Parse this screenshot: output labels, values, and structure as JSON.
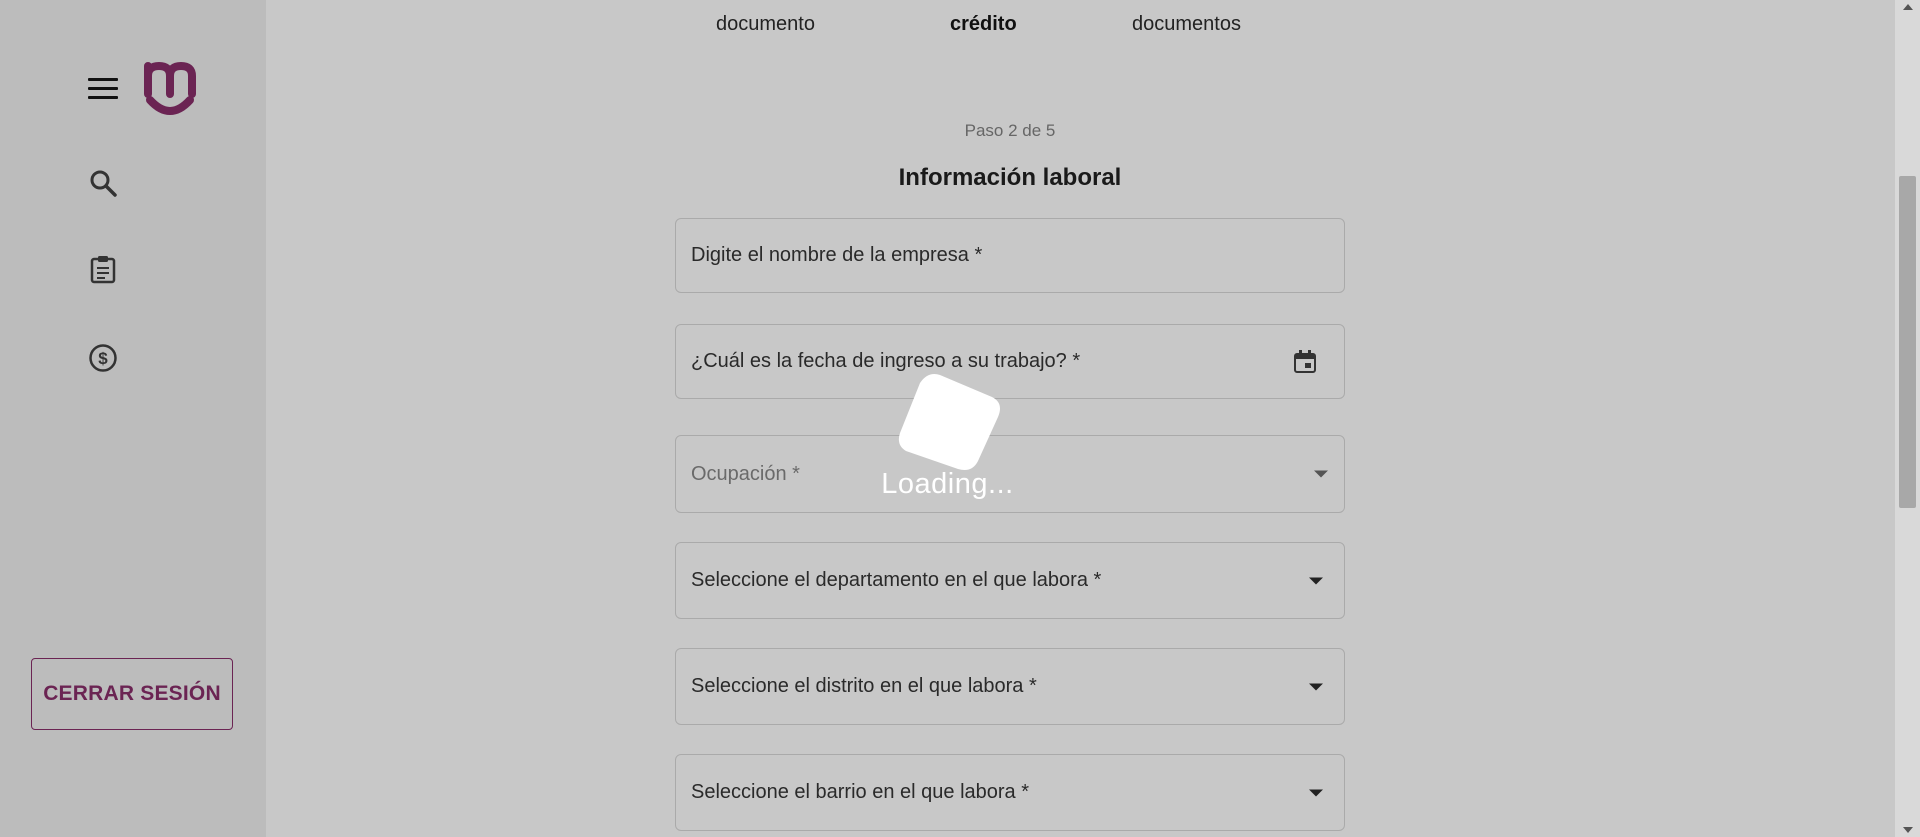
{
  "sidebar": {
    "menu_icon": "hamburger-menu-icon",
    "logo_icon": "brand-logo-icon",
    "nav_items": [
      {
        "icon": "search-icon"
      },
      {
        "icon": "clipboard-icon"
      },
      {
        "icon": "dollar-coin-icon"
      }
    ],
    "logout_label": "CERRAR SESIÓN"
  },
  "stepper": {
    "step1_line2": "documento",
    "step2_line2": "crédito",
    "step3_line2": "documentos"
  },
  "form": {
    "step_counter": "Paso 2 de 5",
    "title": "Información laboral",
    "company_label": "Digite el nombre de la empresa *",
    "start_date_label": "¿Cuál es la fecha de ingreso a su trabajo? *",
    "occupation_label": "Ocupación *",
    "department_label": "Seleccione el departamento en el que labora *",
    "district_label": "Seleccione el distrito en el que labora *",
    "neighborhood_label": "Seleccione el barrio en el que labora *"
  },
  "loading": {
    "text": "Loading..."
  },
  "colors": {
    "brand": "#6b2453",
    "overlay_bg": "#c8c8c8",
    "sidebar_bg": "#bcbcbc"
  }
}
